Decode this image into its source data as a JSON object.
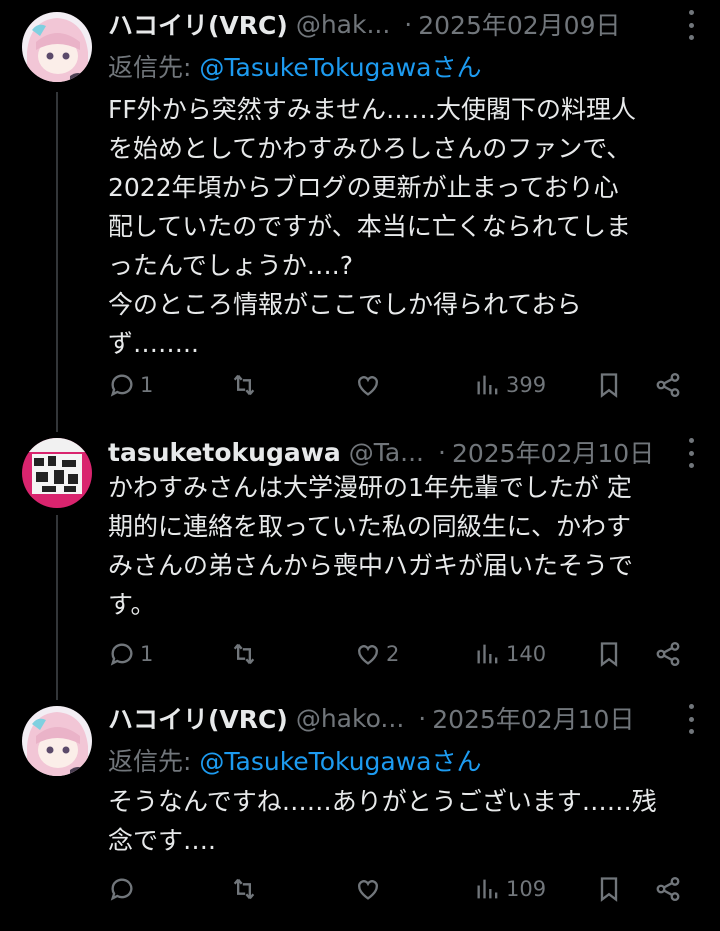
{
  "tweets": [
    {
      "name": "ハコイリ(VRC)",
      "handle": "@hak...",
      "date": "2025年02月09日",
      "reply_prefix": "返信先: ",
      "reply_mention": "@TasukeTokugawaさん",
      "text": "FF外から突然すみません……大使閣下の料理人\nを始めとしてかわすみひろしさんのファンで、\n2022年頃からブログの更新が止まっており心\n配していたのですが、本当に亡くなられてしま\nったんでしょうか….?\n今のところ情報がここでしか得られておら\nず……..",
      "stats": {
        "replies": "1",
        "retweets": "",
        "likes": "",
        "views": "399"
      }
    },
    {
      "name": "tasuketokugawa",
      "handle": "@Ta...",
      "date": "2025年02月10日",
      "text": "かわすみさんは大学漫研の1年先輩でしたが 定\n期的に連絡を取っていた私の同級生に、かわす\nみさんの弟さんから喪中ハガキが届いたそうで\nす。",
      "stats": {
        "replies": "1",
        "retweets": "",
        "likes": "2",
        "views": "140"
      }
    },
    {
      "name": "ハコイリ(VRC)",
      "handle": "@hako...",
      "date": "2025年02月10日",
      "reply_prefix": "返信先: ",
      "reply_mention": "@TasukeTokugawaさん",
      "text": "そうなんですね……ありがとうございます……残\n念です….",
      "stats": {
        "replies": "",
        "retweets": "",
        "likes": "",
        "views": "109"
      }
    }
  ],
  "separator": "·",
  "icons": [
    "reply-icon",
    "retweet-icon",
    "like-icon",
    "views-icon",
    "bookmark-icon",
    "share-icon",
    "more-icon"
  ],
  "colors": {
    "background": "#000000",
    "text": "#e7e9ea",
    "muted": "#71767b",
    "link": "#1d9bf0",
    "thread_line": "#333639"
  }
}
